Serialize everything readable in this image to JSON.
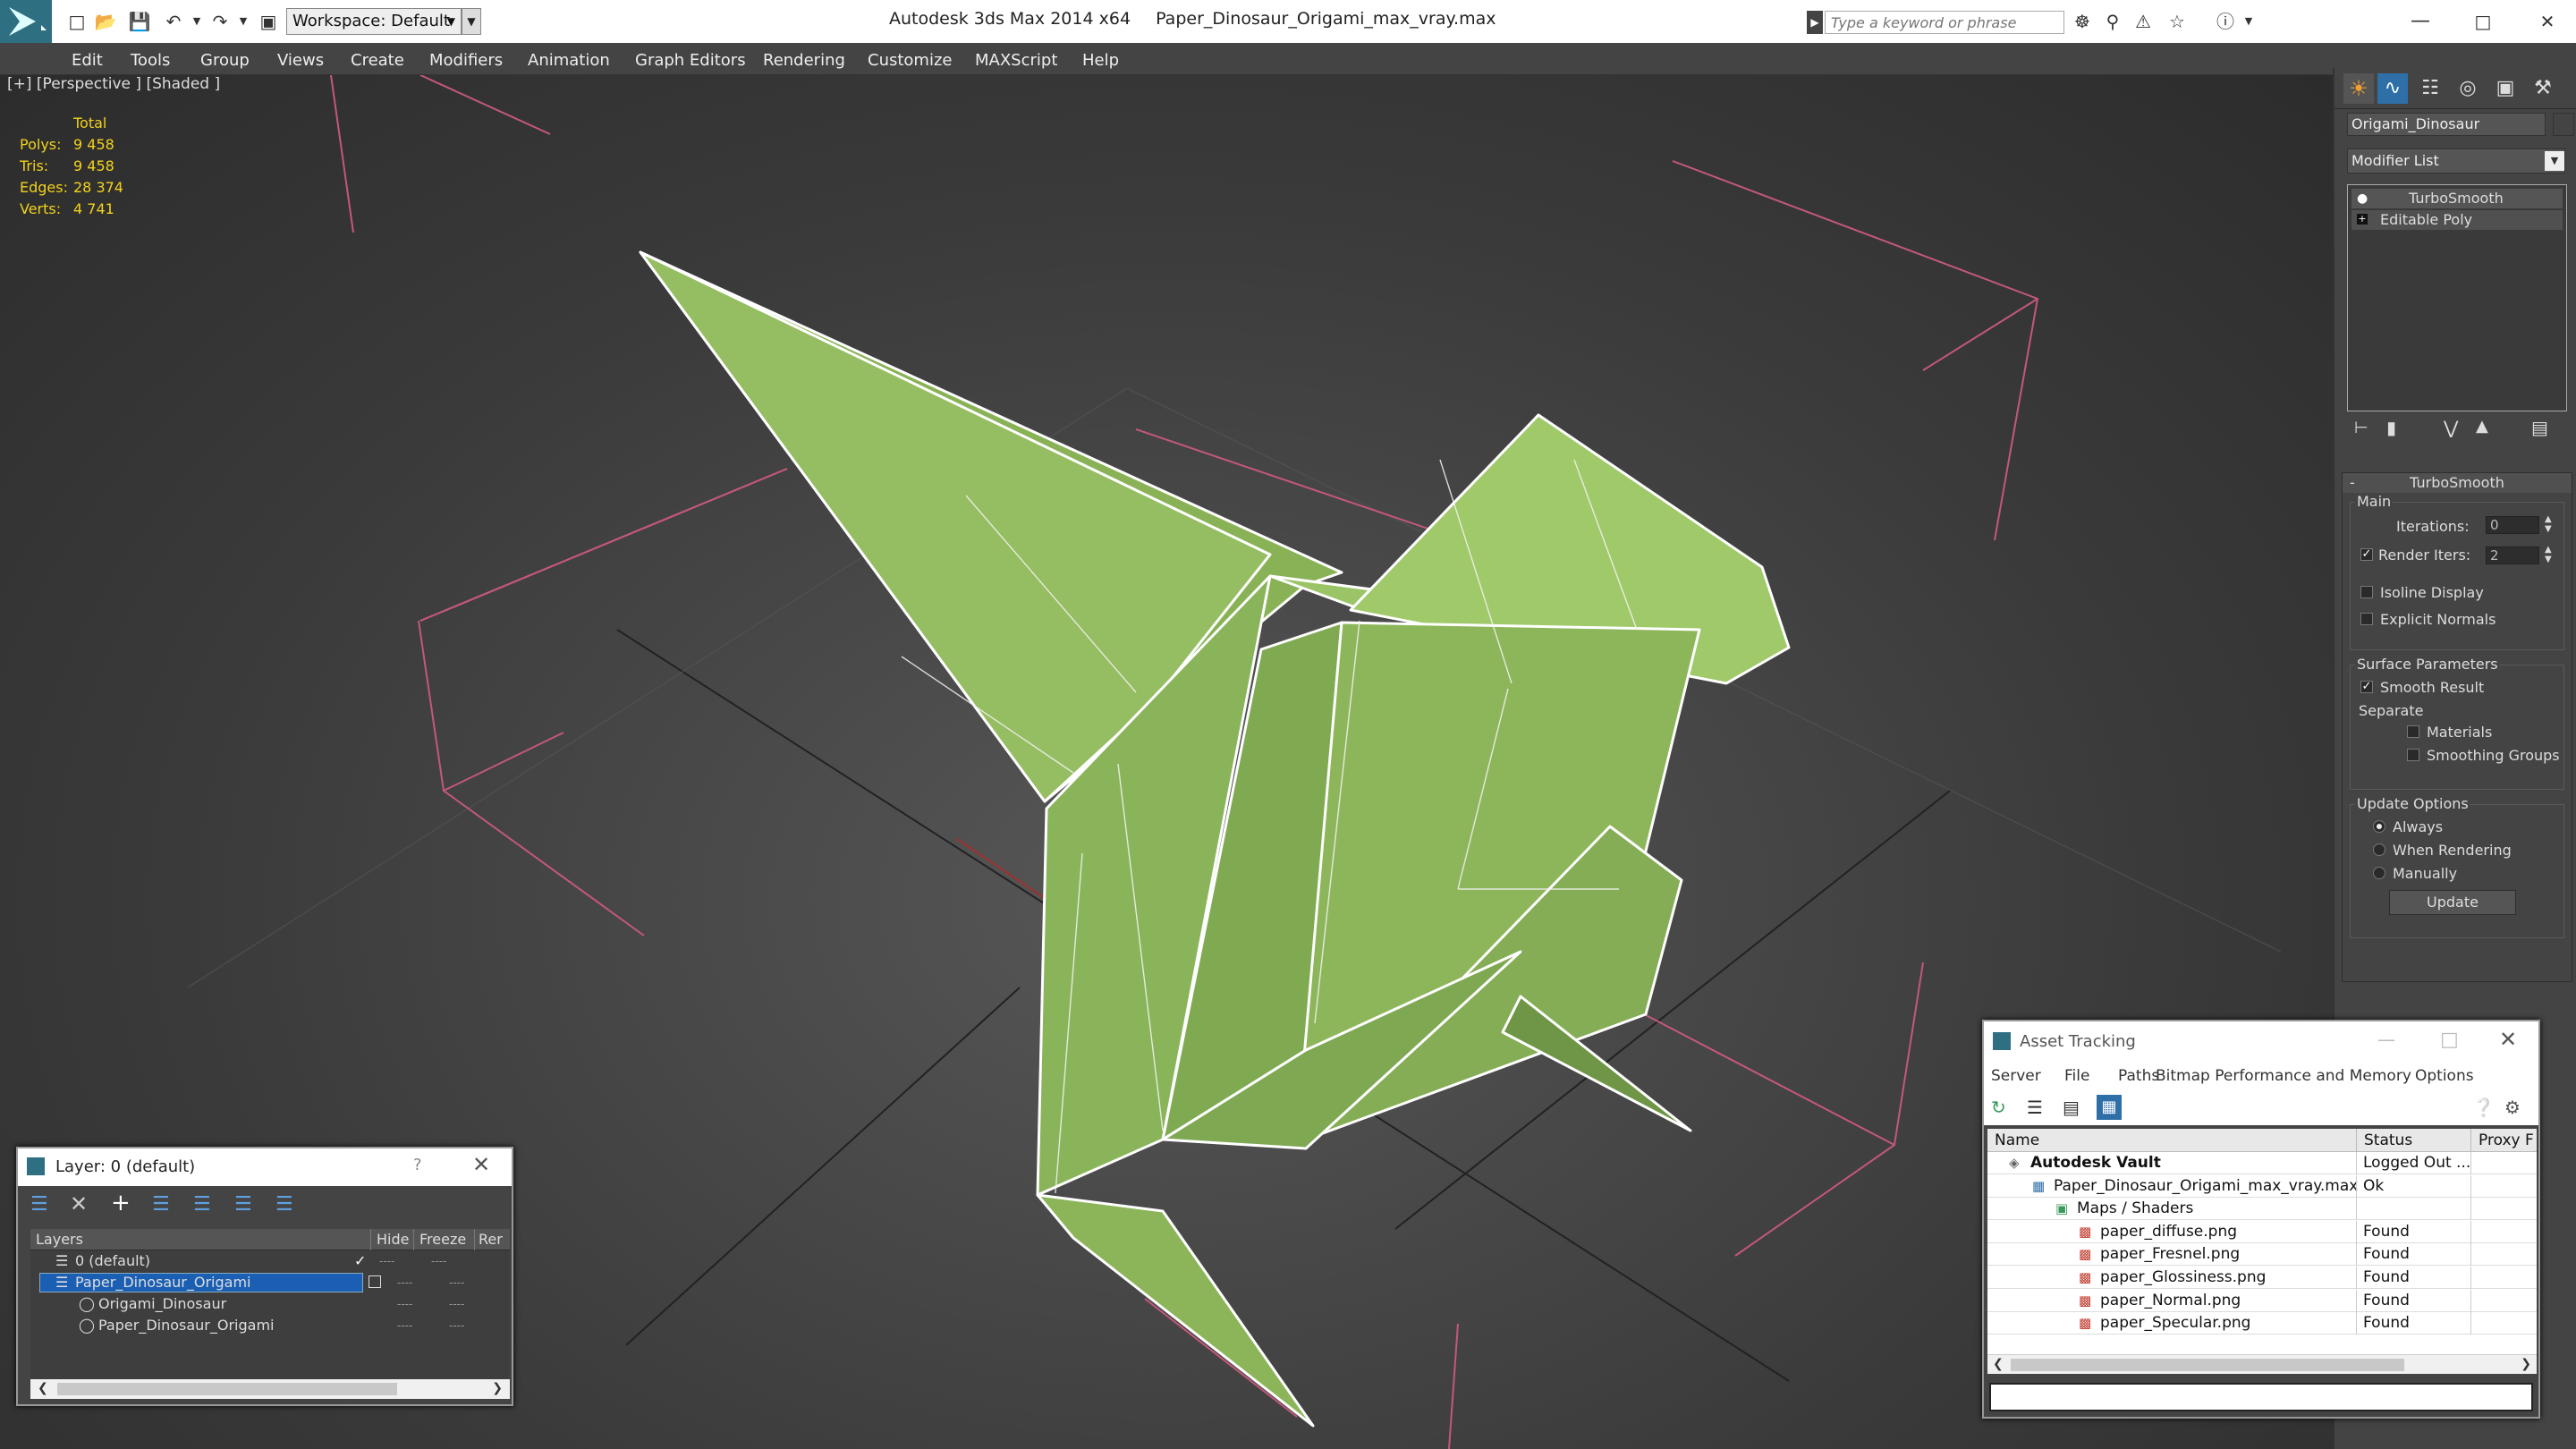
{
  "titlebar": {
    "app": "Autodesk 3ds Max  2014 x64",
    "file": "Paper_Dinosaur_Origami_max_vray.max",
    "workspace": "Workspace: Default",
    "search_placeholder": "Type a keyword or phrase"
  },
  "menu": [
    "Edit",
    "Tools",
    "Group",
    "Views",
    "Create",
    "Modifiers",
    "Animation",
    "Graph Editors",
    "Rendering",
    "Customize",
    "MAXScript",
    "Help"
  ],
  "viewport": {
    "label": "[+] [Perspective ] [Shaded ]",
    "stats": {
      "total_label": "Total",
      "rows": [
        {
          "label": "Polys:",
          "value": "9 458"
        },
        {
          "label": "Tris:",
          "value": "9 458"
        },
        {
          "label": "Edges:",
          "value": "28 374"
        },
        {
          "label": "Verts:",
          "value": "4 741"
        }
      ]
    }
  },
  "command_panel": {
    "object_name": "Origami_Dinosaur",
    "modifier_list": "Modifier List",
    "stack": [
      "TurboSmooth",
      "Editable Poly"
    ],
    "rollout_title": "TurboSmooth",
    "main_label": "Main",
    "iterations_label": "Iterations:",
    "iterations_value": "0",
    "render_iters_label": "Render Iters:",
    "render_iters_value": "2",
    "render_iters_checked": true,
    "isoline": "Isoline Display",
    "explicit_normals": "Explicit Normals",
    "surface_params": "Surface Parameters",
    "smooth_result": "Smooth Result",
    "smooth_result_checked": true,
    "separate": "Separate",
    "materials": "Materials",
    "smoothing_groups": "Smoothing Groups",
    "update_options": "Update Options",
    "always": "Always",
    "when_rendering": "When Rendering",
    "manually": "Manually",
    "update_button": "Update"
  },
  "layer_window": {
    "title": "Layer: 0 (default)",
    "help": "?",
    "columns": [
      "Layers",
      "Hide",
      "Freeze",
      "Rer"
    ],
    "rows": [
      {
        "name": "0 (default)",
        "indent": 0,
        "selected": false
      },
      {
        "name": "Paper_Dinosaur_Origami",
        "indent": 0,
        "selected": true
      },
      {
        "name": "Origami_Dinosaur",
        "indent": 1,
        "selected": false
      },
      {
        "name": "Paper_Dinosaur_Origami",
        "indent": 1,
        "selected": false
      }
    ],
    "dash": "----"
  },
  "asset_window": {
    "title": "Asset Tracking",
    "menu": [
      "Server",
      "File",
      "Paths",
      "Bitmap Performance and Memory",
      "Options"
    ],
    "columns": [
      "Name",
      "Status",
      "Proxy F"
    ],
    "rows": [
      {
        "name": "Autodesk Vault",
        "status": "Logged Out ...",
        "indent": 0
      },
      {
        "name": "Paper_Dinosaur_Origami_max_vray.max",
        "status": "Ok",
        "indent": 1
      },
      {
        "name": "Maps / Shaders",
        "status": "",
        "indent": 2
      },
      {
        "name": "paper_diffuse.png",
        "status": "Found",
        "indent": 3
      },
      {
        "name": "paper_Fresnel.png",
        "status": "Found",
        "indent": 3
      },
      {
        "name": "paper_Glossiness.png",
        "status": "Found",
        "indent": 3
      },
      {
        "name": "paper_Normal.png",
        "status": "Found",
        "indent": 3
      },
      {
        "name": "paper_Specular.png",
        "status": "Found",
        "indent": 3
      }
    ]
  },
  "colors": {
    "paper_green": "#8db65a",
    "selection": "#1a5fb4",
    "stats_yellow": "#f2d21b",
    "bracket_pink": "#c4587a"
  }
}
